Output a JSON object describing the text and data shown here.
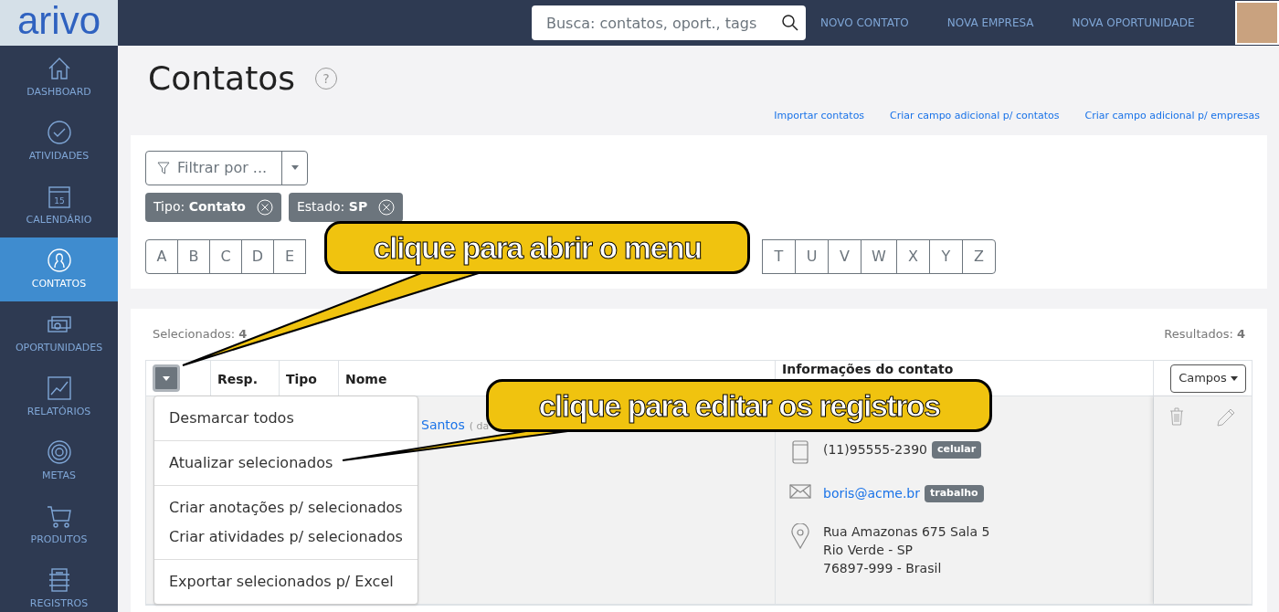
{
  "logo": "arivo",
  "search": {
    "placeholder": "Busca: contatos, oport., tags"
  },
  "top_links": [
    "NOVO CONTATO",
    "NOVA EMPRESA",
    "NOVA OPORTUNIDADE"
  ],
  "sidebar": {
    "items": [
      {
        "label": "DASHBOARD",
        "kind": "home",
        "selected": false
      },
      {
        "label": "ATIVIDADES",
        "kind": "check",
        "selected": false
      },
      {
        "label": "CALENDÁRIO",
        "kind": "calendar",
        "day": "15",
        "selected": false
      },
      {
        "label": "CONTATOS",
        "kind": "user",
        "selected": true
      },
      {
        "label": "OPORTUNIDADES",
        "kind": "money",
        "selected": false
      },
      {
        "label": "RELATÓRIOS",
        "kind": "chart",
        "selected": false
      },
      {
        "label": "METAS",
        "kind": "target",
        "selected": false
      },
      {
        "label": "PRODUTOS",
        "kind": "cart",
        "selected": false
      },
      {
        "label": "REGISTROS",
        "kind": "register",
        "selected": false
      }
    ]
  },
  "page_title": "Contatos",
  "help": "?",
  "page_links": [
    "Importar contatos",
    "Criar campo adicional p/ contatos",
    "Criar campo adicional p/ empresas"
  ],
  "filter": {
    "placeholder": "Filtrar por ..."
  },
  "chips": [
    {
      "label": "Tipo:",
      "value": "Contato"
    },
    {
      "label": "Estado:",
      "value": "SP"
    }
  ],
  "letters_left": [
    "A",
    "B",
    "C",
    "D",
    "E"
  ],
  "letters_right": [
    "T",
    "U",
    "V",
    "W",
    "X",
    "Y",
    "Z"
  ],
  "selected_count": {
    "label": "Selecionados:",
    "value": "4"
  },
  "results_count": {
    "label": "Resultados:",
    "value": "4"
  },
  "table": {
    "columns": [
      "Resp.",
      "Tipo",
      "Nome",
      "Informações do contato"
    ],
    "fields_button": "Campos",
    "rows": [
      {
        "name": "Santos",
        "note": "( da",
        "contacts": [
          {
            "kind": "phone",
            "text": "(11)95555-2390",
            "tag": "celular"
          },
          {
            "kind": "email",
            "text": "boris@acme.br",
            "tag": "trabalho"
          },
          {
            "kind": "address",
            "lines": [
              "Rua Amazonas 675 Sala 5",
              "Rio Verde - SP",
              "76897-999 - Brasil"
            ]
          }
        ]
      }
    ]
  },
  "menu": {
    "sections": [
      [
        "Desmarcar todos"
      ],
      [
        "Atualizar selecionados"
      ],
      [
        "Criar anotações p/ selecionados",
        "Criar atividades p/ selecionados"
      ],
      [
        "Exportar selecionados p/ Excel"
      ]
    ]
  },
  "callouts": [
    {
      "text": "clique para abrir o menu"
    },
    {
      "text": "clique para editar os registros"
    }
  ]
}
